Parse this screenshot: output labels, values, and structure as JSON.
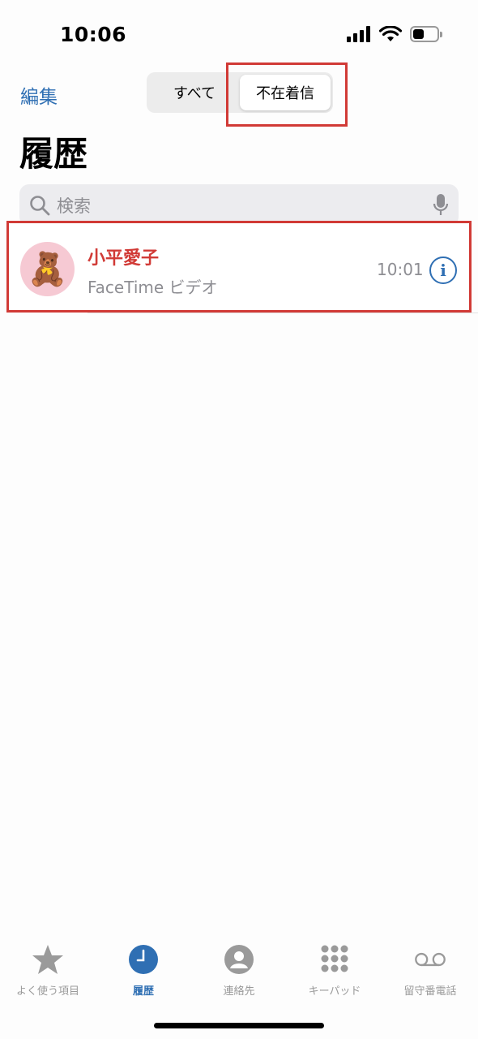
{
  "status_bar": {
    "time": "10:06",
    "battery_level": 0.45
  },
  "nav": {
    "edit_label": "編集",
    "segments": [
      {
        "label": "すべて",
        "selected": false
      },
      {
        "label": "不在着信",
        "selected": true
      }
    ]
  },
  "page": {
    "title": "履歴"
  },
  "search": {
    "placeholder": "検索"
  },
  "calls": [
    {
      "name": "小平愛子",
      "type": "FaceTime ビデオ",
      "time": "10:01",
      "avatar_emoji": "🧸",
      "missed": true
    }
  ],
  "tab_bar": {
    "tabs": [
      {
        "label": "よく使う項目",
        "icon": "star-icon",
        "active": false
      },
      {
        "label": "履歴",
        "icon": "clock-icon",
        "active": true
      },
      {
        "label": "連絡先",
        "icon": "contact-icon",
        "active": false
      },
      {
        "label": "キーパッド",
        "icon": "keypad-icon",
        "active": false
      },
      {
        "label": "留守番電話",
        "icon": "voicemail-icon",
        "active": false
      }
    ]
  },
  "colors": {
    "accent": "#2f6fb3",
    "missed": "#d13a36",
    "inactive": "#9a9a9a",
    "highlight": "#d13a36"
  }
}
